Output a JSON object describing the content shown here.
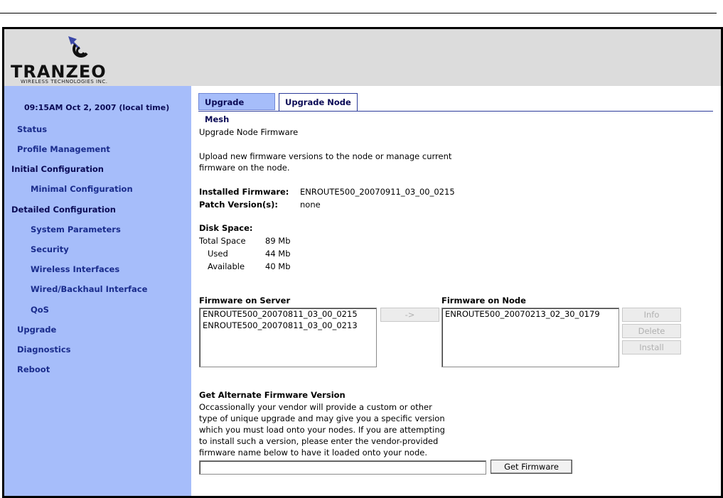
{
  "brand": {
    "logo_word": "TRANZEO",
    "logo_sub": "WIRELESS TECHNOLOGIES INC."
  },
  "sidebar": {
    "time": "09:15AM Oct 2, 2007 (local time)",
    "items": [
      {
        "label": "Status"
      },
      {
        "label": "Profile Management"
      },
      {
        "label": "Initial Configuration"
      },
      {
        "label": "Minimal Configuration"
      },
      {
        "label": "Detailed Configuration"
      },
      {
        "label": "System Parameters"
      },
      {
        "label": "Security"
      },
      {
        "label": "Wireless Interfaces"
      },
      {
        "label": "Wired/Backhaul Interface"
      },
      {
        "label": "QoS"
      },
      {
        "label": "Upgrade"
      },
      {
        "label": "Diagnostics"
      },
      {
        "label": "Reboot"
      }
    ]
  },
  "tabs": [
    {
      "label": "Upgrade Mesh"
    },
    {
      "label": "Upgrade Node"
    }
  ],
  "main": {
    "heading": "Upgrade Node Firmware",
    "desc_line1": "Upload new firmware versions to the node or manage current",
    "desc_line2": "firmware on the node.",
    "installed_label": "Installed Firmware:",
    "installed_value": "ENROUTE500_20070911_03_00_0215",
    "patch_label": "Patch Version(s):",
    "patch_value": "none",
    "disk_heading": "Disk Space:",
    "disk_rows": [
      {
        "label": "Total Space",
        "value": "89 Mb"
      },
      {
        "label": "Used",
        "value": "44 Mb"
      },
      {
        "label": "Available",
        "value": "40 Mb"
      }
    ],
    "server_heading": "Firmware on Server",
    "server_items": [
      "ENROUTE500_20070811_03_00_0215",
      "ENROUTE500_20070811_03_00_0213"
    ],
    "transfer_button": "->",
    "node_heading": "Firmware on Node",
    "node_items": [
      "ENROUTE500_20070213_02_30_0179"
    ],
    "buttons": {
      "info": "Info",
      "delete": "Delete",
      "install": "Install"
    },
    "alt_heading": "Get Alternate Firmware Version",
    "alt_lines": [
      "Occassionally your vendor will provide a custom or other",
      "type of unique upgrade and may give you a specific version",
      "which you must load onto your nodes. If you are attempting",
      "to install such a version, please enter the vendor-provided",
      "firmware name below to have it loaded onto your node."
    ],
    "alt_input_value": "",
    "get_button": "Get Firmware"
  }
}
